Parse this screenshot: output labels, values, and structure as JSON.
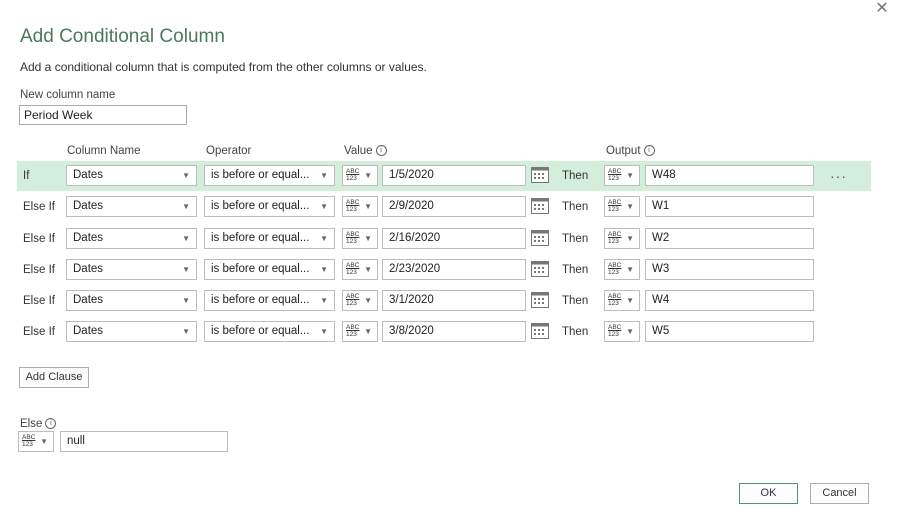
{
  "dialog": {
    "close_glyph": "✕",
    "title": "Add Conditional Column",
    "description": "Add a conditional column that is computed from the other columns or values.",
    "new_column_label": "New column name",
    "new_column_value": "Period Week"
  },
  "headers": {
    "column_name": "Column Name",
    "operator": "Operator",
    "value": "Value",
    "output": "Output",
    "info_glyph": "i"
  },
  "type_icon": {
    "top": "ABC",
    "bottom": "123"
  },
  "then_label": "Then",
  "more_glyph": "···",
  "rows": [
    {
      "label": "If",
      "column": "Dates",
      "operator": "is before or equal...",
      "value": "1/5/2020",
      "output": "W48"
    },
    {
      "label": "Else If",
      "column": "Dates",
      "operator": "is before or equal...",
      "value": "2/9/2020",
      "output": "W1"
    },
    {
      "label": "Else If",
      "column": "Dates",
      "operator": "is before or equal...",
      "value": "2/16/2020",
      "output": "W2"
    },
    {
      "label": "Else If",
      "column": "Dates",
      "operator": "is before or equal...",
      "value": "2/23/2020",
      "output": "W3"
    },
    {
      "label": "Else If",
      "column": "Dates",
      "operator": "is before or equal...",
      "value": "3/1/2020",
      "output": "W4"
    },
    {
      "label": "Else If",
      "column": "Dates",
      "operator": "is before or equal...",
      "value": "3/8/2020",
      "output": "W5"
    }
  ],
  "add_clause_label": "Add Clause",
  "else": {
    "label": "Else",
    "value": "null"
  },
  "buttons": {
    "ok": "OK",
    "cancel": "Cancel"
  },
  "colors": {
    "accent": "#4a7a5a",
    "selected_row": "#d4eedc",
    "ok_border": "#4b9b6a"
  }
}
